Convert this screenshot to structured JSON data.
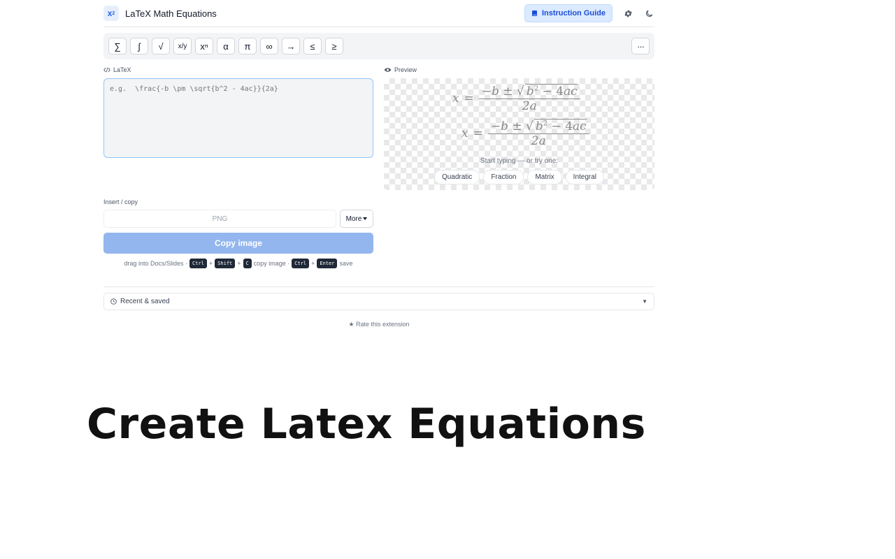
{
  "header": {
    "logo_text": "x",
    "logo_sup": "2",
    "title": "LaTeX Math Equations",
    "guide_label": "Instruction Guide"
  },
  "toolbar": {
    "symbols": [
      "∑",
      "∫",
      "√",
      "x/y",
      "xⁿ",
      "α",
      "π",
      "∞",
      "→",
      "≤",
      "≥"
    ],
    "more_label": "···"
  },
  "editor": {
    "label": "LaTeX",
    "placeholder": "e.g.  \\frac{-b \\pm \\sqrt{b^2 - 4ac}}{2a}"
  },
  "preview": {
    "label": "Preview",
    "try_text": "Start typing — or try one:",
    "chips": [
      "Quadratic",
      "Fraction",
      "Matrix",
      "Integral"
    ]
  },
  "insert": {
    "label": "Insert / copy",
    "format_value": "PNG",
    "more_label": "More",
    "copy_label": "Copy image",
    "hint_drag": "drag into Docs/Slides ·",
    "hint_copy": "copy image ·",
    "hint_save": "save",
    "keys_copy": [
      "Ctrl",
      "Shift",
      "C"
    ],
    "keys_save": [
      "Ctrl",
      "Enter"
    ]
  },
  "recent": {
    "label": "Recent & saved"
  },
  "rate": "★ Rate this extension",
  "caption": "Create Latex Equations",
  "colors": {
    "accent": "#2563eb",
    "copy_button": "#93b6ee",
    "guide_bg": "#dbeafe"
  }
}
